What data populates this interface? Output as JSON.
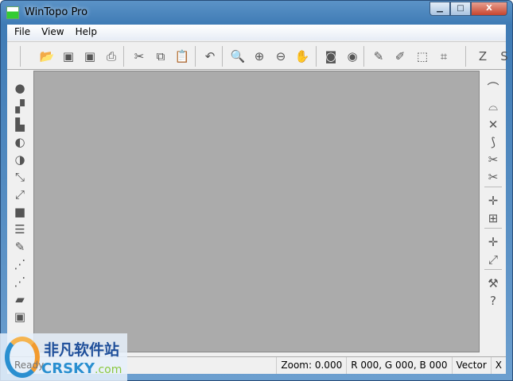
{
  "window": {
    "title": "WinTopo Pro",
    "minimize": "▁",
    "maximize": "□",
    "close": "X"
  },
  "menu": [
    "File",
    "View",
    "Help"
  ],
  "toolbar": [
    {
      "name": "open",
      "glyph": "📂"
    },
    {
      "name": "save",
      "glyph": "▣"
    },
    {
      "name": "save-as",
      "glyph": "▣"
    },
    {
      "name": "print",
      "glyph": "⎙"
    },
    {
      "name": "cut",
      "glyph": "✂"
    },
    {
      "name": "copy",
      "glyph": "⧉"
    },
    {
      "name": "paste",
      "glyph": "📋"
    },
    {
      "name": "undo",
      "glyph": "↶"
    },
    {
      "name": "zoom",
      "glyph": "🔍"
    },
    {
      "name": "zoom-in",
      "glyph": "⊕"
    },
    {
      "name": "zoom-out",
      "glyph": "⊖"
    },
    {
      "name": "pan",
      "glyph": "✋"
    },
    {
      "name": "raster-1",
      "glyph": "◙"
    },
    {
      "name": "raster-2",
      "glyph": "◉"
    },
    {
      "name": "pencil",
      "glyph": "✎"
    },
    {
      "name": "edit-line",
      "glyph": "✐"
    },
    {
      "name": "edit-area",
      "glyph": "⬚"
    },
    {
      "name": "crop",
      "glyph": "⌗"
    },
    {
      "name": "z-tool",
      "glyph": "Z"
    },
    {
      "name": "s-tool",
      "glyph": "S"
    }
  ],
  "left_toolbar": [
    "●",
    "▞",
    "▙",
    "◐",
    "◑",
    "⤡",
    "⤢",
    "■",
    "☰",
    "✎",
    "⋰",
    "⋰",
    "▰",
    "▣"
  ],
  "right_toolbar": [
    "⌒",
    "⌓",
    "✕",
    "⟆",
    "✂",
    "✂",
    "✛",
    "⊞",
    "✛",
    "⤢",
    "⚒",
    "?"
  ],
  "status": {
    "ready": "Ready",
    "zoom": "Zoom: 0.000",
    "rgb": "R 000, G 000, B 000",
    "mode": "Vector",
    "x": "X"
  },
  "watermark": {
    "cn": "非凡软件站",
    "en": "CRSKY",
    ".com": ".com"
  }
}
